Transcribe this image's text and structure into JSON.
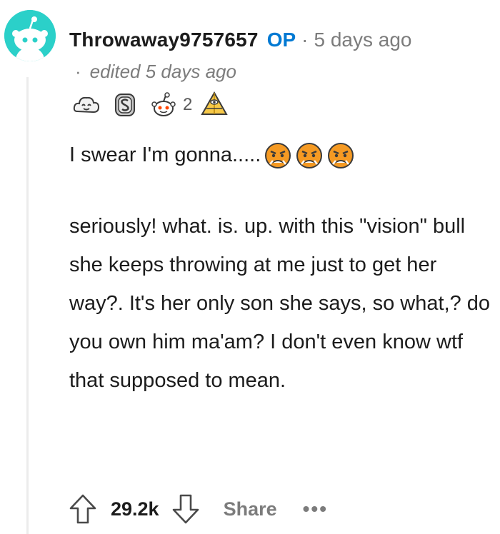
{
  "comment": {
    "author": "Throwaway9757657",
    "op_badge": "OP",
    "separator": "·",
    "timestamp": "5 days ago",
    "edited": "edited 5 days ago",
    "awards": [
      {
        "icon": "happy-cloud-award-icon"
      },
      {
        "icon": "silver-coin-award-icon"
      },
      {
        "icon": "snoo-award-icon",
        "count": "2"
      },
      {
        "icon": "gold-pyramid-award-icon"
      }
    ],
    "body_line1": "I swear I'm gonna.....",
    "angry_emojis": [
      "angry-face-icon",
      "angry-face-icon",
      "angry-face-icon"
    ],
    "body_paragraph2": "seriously! what. is. up. with this \"vision\" bull she keeps throwing at me just to get her way?. It's her only son she says, so what,? do you own him ma'am? I don't even know wtf that supposed to mean.",
    "score": "29.2k",
    "share_label": "Share",
    "more_label": "•••"
  },
  "colors": {
    "avatar_bg": "#2bd0c9",
    "op_blue": "#0079d3",
    "meta_gray": "#7c7c7c",
    "emoji_orange": "#f59a23"
  }
}
